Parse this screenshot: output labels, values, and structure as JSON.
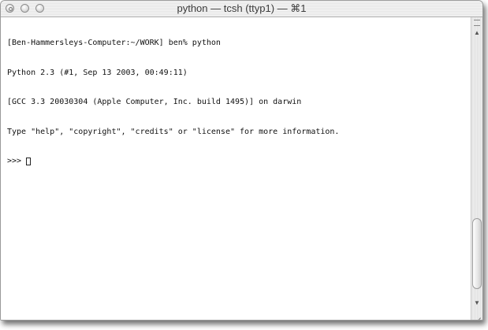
{
  "window": {
    "title": "python — tcsh (ttyp1) — ⌘1"
  },
  "terminal": {
    "lines": [
      "[Ben-Hammersleys-Computer:~/WORK] ben% python",
      "Python 2.3 (#1, Sep 13 2003, 00:49:11)",
      "[GCC 3.3 20030304 (Apple Computer, Inc. build 1495)] on darwin",
      "Type \"help\", \"copyright\", \"credits\" or \"license\" for more information."
    ],
    "prompt": ">>>"
  },
  "icons": {
    "close": "close-icon",
    "minimize": "minimize-icon",
    "zoom": "zoom-icon",
    "scroll_up": "arrow-up-icon",
    "scroll_down": "arrow-down-icon",
    "resize": "resize-grip-icon"
  }
}
